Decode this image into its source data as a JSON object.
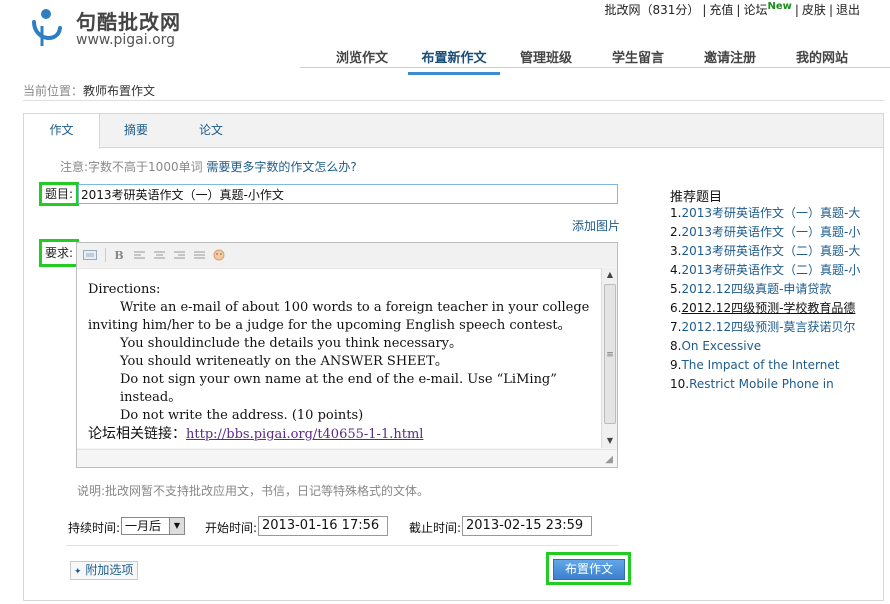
{
  "header": {
    "logo_cn": "句酷批改网",
    "logo_en": "www.pigai.org",
    "account": "批改网（831分）",
    "top_links": [
      "充值",
      "论坛",
      "皮肤",
      "退出"
    ],
    "new_badge": "New"
  },
  "nav": [
    "浏览作文",
    "布置新作文",
    "管理班级",
    "学生留言",
    "邀请注册",
    "我的网站"
  ],
  "breadcrumb": {
    "prefix": "当前位置：",
    "current": "教师布置作文"
  },
  "tabs": [
    "作文",
    "摘要",
    "论文"
  ],
  "note": {
    "text": "注意:字数不高于1000单词",
    "link": "需要更多字数的作文怎么办?"
  },
  "form": {
    "title_label": "题目:",
    "title_value": "2013考研英语作文（一）真题-小作文",
    "add_picture": "添加图片",
    "req_label": "要求:",
    "requirement": {
      "line1": "Directions:",
      "line2": "Write an e-mail of about 100 words to a foreign teacher in your college",
      "line3": "inviting him/her to be a judge for the upcoming English speech contest。",
      "line4": "You shouldinclude the details you think necessary。",
      "line5": "You should writeneatly on the ANSWER SHEET。",
      "line6": "Do not sign your own name at the end of the e-mail. Use “LiMing” instead。",
      "line7": "Do not write the address. (10 points)",
      "forum_label": "论坛相关链接：",
      "forum_link": "http://bbs.pigai.org/t40655-1-1.html"
    },
    "description": "说明:批改网暂不支持批改应用文，书信，日记等特殊格式的文体。",
    "duration_label": "持续时间:",
    "duration_value": "一月后",
    "start_label": "开始时间:",
    "start_value": "2013-01-16 17:56",
    "end_label": "截止时间:",
    "end_value": "2013-02-15 23:59",
    "extra_options": "附加选项",
    "submit": "布置作文"
  },
  "recommend": {
    "title": "推荐题目",
    "items": [
      {
        "num": "1.",
        "text": "2013考研英语作文（一）真题-大"
      },
      {
        "num": "2.",
        "text": "2013考研英语作文（一）真题-小"
      },
      {
        "num": "3.",
        "text": "2013考研英语作文（二）真题-大"
      },
      {
        "num": "4.",
        "text": "2013考研英语作文（二）真题-小"
      },
      {
        "num": "5.",
        "text": "2012.12四级真题-申请贷款"
      },
      {
        "num": "6.",
        "text": "2012.12四级预测-学校教育品德"
      },
      {
        "num": "7.",
        "text": "2012.12四级预测-莫言获诺贝尔"
      },
      {
        "num": "8.",
        "text": "On Excessive"
      },
      {
        "num": "9.",
        "text": "The Impact of the Internet"
      },
      {
        "num": "10.",
        "text": "Restrict Mobile Phone in"
      }
    ]
  },
  "colors": {
    "accent": "#3b8dd1",
    "link": "#1d5b8c",
    "highlight": "#22cc22"
  }
}
